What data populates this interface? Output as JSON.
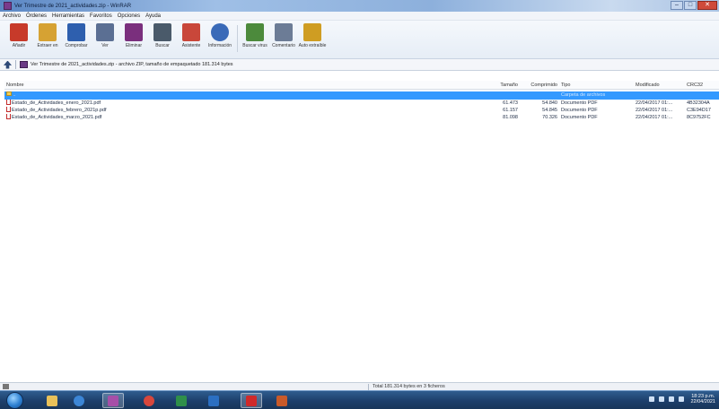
{
  "window": {
    "title": "Ver Trimestre de 2021_actividades.zip - WinRAR"
  },
  "menu": [
    "Archivo",
    "Órdenes",
    "Herramientas",
    "Favoritos",
    "Opciones",
    "Ayuda"
  ],
  "toolbar": [
    {
      "label": "Añadir",
      "icon": "add-icon",
      "color": "#c73a2a"
    },
    {
      "label": "Extraer en",
      "icon": "extract-icon",
      "color": "#d6a233"
    },
    {
      "label": "Comprobar",
      "icon": "test-icon",
      "color": "#2e5fae"
    },
    {
      "label": "Ver",
      "icon": "view-icon",
      "color": "#5b6f93"
    },
    {
      "label": "Eliminar",
      "icon": "delete-icon",
      "color": "#7a2f7d"
    },
    {
      "label": "Buscar",
      "icon": "find-icon",
      "color": "#4a5a6a"
    },
    {
      "label": "Asistente",
      "icon": "wizard-icon",
      "color": "#c9473a"
    },
    {
      "label": "Información",
      "icon": "info-icon",
      "color": "#3a6ab8"
    },
    {
      "label": "Buscar virus",
      "icon": "virus-scan-icon",
      "color": "#4c8a3c"
    },
    {
      "label": "Comentario",
      "icon": "comment-icon",
      "color": "#6c7c96"
    },
    {
      "label": "Auto extraíble",
      "icon": "sfx-icon",
      "color": "#cf9d22"
    }
  ],
  "address": {
    "text": "Ver Trimestre de 2021_actividades.zip - archivo ZIP, tamaño de empaquetado 181.314 bytes"
  },
  "columns": {
    "name": "Nombre",
    "size": "Tamaño",
    "packed": "Comprimido",
    "type": "Tipo",
    "modified": "Modificado",
    "crc": "CRC32"
  },
  "rows": [
    {
      "name": "..",
      "size": "",
      "packed": "",
      "type": "Carpeta de archivos",
      "modified": "",
      "crc": ""
    },
    {
      "name": "Estado_de_Actividades_enero_2021.pdf",
      "size": "61.473",
      "packed": "54.840",
      "type": "Documento PDF",
      "modified": "22/04/2017 01:...",
      "crc": "4B32304A"
    },
    {
      "name": "Estado_de_Actividades_febrero_2021p.pdf",
      "size": "61.157",
      "packed": "54.845",
      "type": "Documento PDF",
      "modified": "22/04/2017 01:...",
      "crc": "C3E94D17"
    },
    {
      "name": "Estado_de_Actividades_marzo_2021.pdf",
      "size": "81.098",
      "packed": "70.326",
      "type": "Documento PDF",
      "modified": "22/04/2017 01:...",
      "crc": "8C9752FC"
    }
  ],
  "status": {
    "left": "",
    "right": "Total 181.314 bytes en 3 ficheros"
  },
  "taskbar": {
    "apps": [
      {
        "icon": "explorer-icon",
        "color": "#e8c15a"
      },
      {
        "icon": "media-player-icon",
        "color": "#3c86d6"
      },
      {
        "icon": "winrar-icon",
        "color": "#a64fa8"
      },
      {
        "icon": "chrome-icon",
        "color": "#d8473c"
      },
      {
        "icon": "excel-icon",
        "color": "#2f8f4a"
      },
      {
        "icon": "outlook-icon",
        "color": "#2b6fc2"
      },
      {
        "icon": "pdf-reader-icon",
        "color": "#d02a2a"
      },
      {
        "icon": "powerpoint-icon",
        "color": "#c85a2a"
      }
    ],
    "clock_time": "18:23 p.m.",
    "clock_date": "22/04/2021"
  }
}
